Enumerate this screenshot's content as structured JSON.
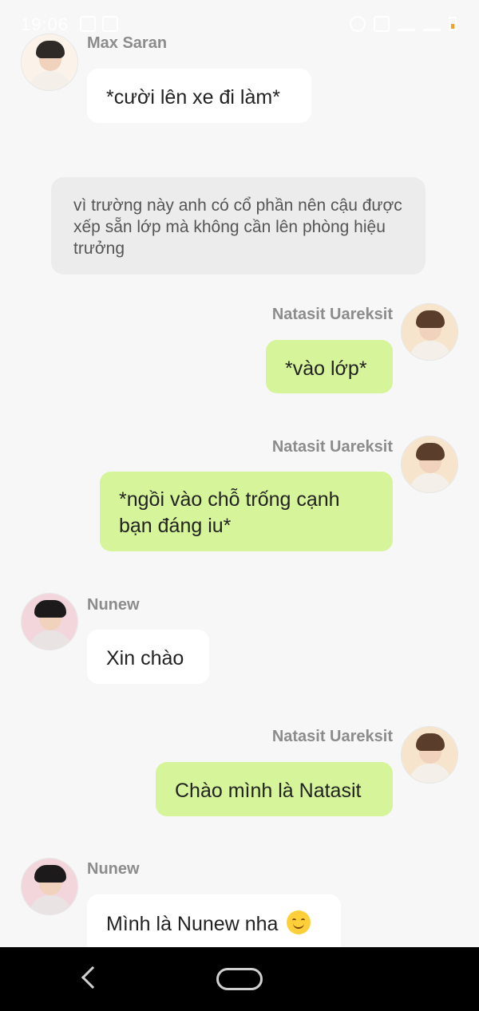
{
  "status_bar": {
    "time": "19:06"
  },
  "messages": [
    {
      "sender": "Max Saran",
      "text": "*cười lên xe đi làm*"
    },
    {
      "narration": "vì trường này anh có cổ phần nên cậu được xếp sẵn lớp mà không cần lên phòng hiệu trưởng"
    },
    {
      "sender": "Natasit  Uareksit",
      "text": "*vào lớp*"
    },
    {
      "sender": "Natasit  Uareksit",
      "text": "*ngồi vào chỗ trống cạnh bạn đáng iu*"
    },
    {
      "sender": "Nunew",
      "text": "Xin chào"
    },
    {
      "sender": "Natasit  Uareksit",
      "text": "Chào mình là Natasit"
    },
    {
      "sender": "Nunew",
      "text": "Mình là Nunew nha",
      "emoji": "smiling-face-emoji"
    }
  ],
  "colors": {
    "background": "#f7f7f7",
    "incoming_bubble": "#ffffff",
    "outgoing_bubble": "#d6f59a",
    "narration_bubble": "#ececec",
    "name_text": "#8c8c8c",
    "nav_bar": "#000000"
  }
}
